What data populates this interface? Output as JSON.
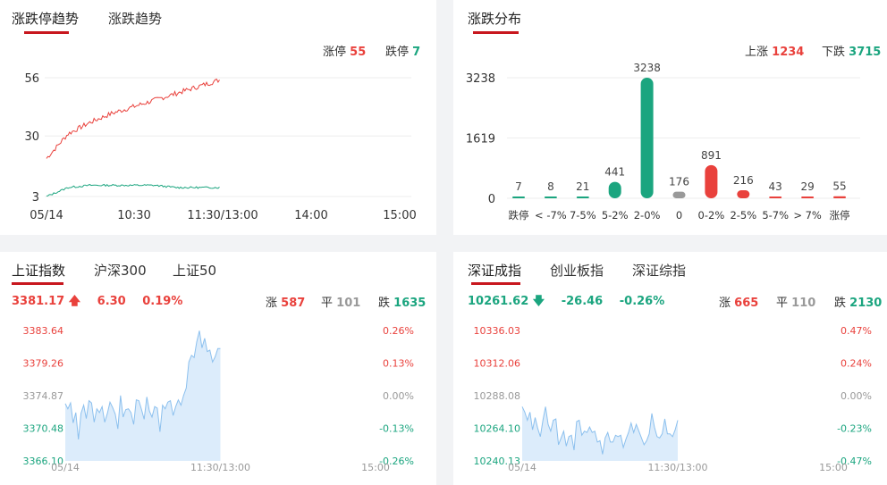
{
  "trend": {
    "tabs": [
      {
        "label": "涨跌停趋势"
      },
      {
        "label": "涨跌趋势"
      }
    ],
    "limit_up_label": "涨停",
    "limit_up_value": "55",
    "limit_down_label": "跌停",
    "limit_down_value": "7",
    "y_ticks": [
      "56",
      "30",
      "3"
    ],
    "x_ticks": [
      "05/14",
      "10:30",
      "11:30/13:00",
      "14:00",
      "15:00"
    ],
    "colors": {
      "up": "#e9413c",
      "down": "#1ba57f"
    }
  },
  "dist": {
    "title": "涨跌分布",
    "up_label": "上涨",
    "up_value": "1234",
    "down_label": "下跌",
    "down_value": "3715",
    "y_ticks": [
      "3238",
      "1619",
      "0"
    ]
  },
  "sh": {
    "tabs": [
      {
        "label": "上证指数"
      },
      {
        "label": "沪深300"
      },
      {
        "label": "上证50"
      }
    ],
    "price": "3381.17",
    "change": "6.30",
    "change_pct": "0.19%",
    "rise_label": "涨",
    "rise_value": "587",
    "flat_label": "平",
    "flat_value": "101",
    "fall_label": "跌",
    "fall_value": "1635",
    "left_ticks": [
      "3383.64",
      "3379.26",
      "3374.87",
      "3370.48",
      "3366.10"
    ],
    "right_ticks": [
      "0.26%",
      "0.13%",
      "0.00%",
      "-0.13%",
      "-0.26%"
    ],
    "x_ticks": [
      "05/14",
      "11:30/13:00",
      "15:00"
    ]
  },
  "sz": {
    "tabs": [
      {
        "label": "深证成指"
      },
      {
        "label": "创业板指"
      },
      {
        "label": "深证综指"
      }
    ],
    "price": "10261.62",
    "change": "-26.46",
    "change_pct": "-0.26%",
    "rise_label": "涨",
    "rise_value": "665",
    "flat_label": "平",
    "flat_value": "110",
    "fall_label": "跌",
    "fall_value": "2130",
    "left_ticks": [
      "10336.03",
      "10312.06",
      "10288.08",
      "10264.10",
      "10240.13"
    ],
    "right_ticks": [
      "0.47%",
      "0.24%",
      "0.00%",
      "-0.23%",
      "-0.47%"
    ],
    "x_ticks": [
      "05/14",
      "11:30/13:00",
      "15:00"
    ]
  },
  "chart_data": [
    {
      "type": "line",
      "x": [
        "05/14",
        "10:30",
        "11:30/13:00",
        "14:00",
        "15:00"
      ],
      "ylim": [
        3,
        56
      ],
      "series": [
        {
          "name": "涨停",
          "values": [
            20,
            31,
            36,
            40,
            43,
            46,
            49,
            52,
            55
          ]
        },
        {
          "name": "跌停",
          "values": [
            3,
            7,
            8,
            8,
            8,
            8,
            7,
            7,
            7
          ]
        }
      ]
    },
    {
      "type": "bar",
      "categories": [
        "跌停",
        "< -7%",
        "7-5%",
        "5-2%",
        "2-0%",
        "0",
        "0-2%",
        "2-5%",
        "5-7%",
        "> 7%",
        "涨停"
      ],
      "values": [
        7,
        8,
        21,
        441,
        3238,
        176,
        891,
        216,
        43,
        29,
        55
      ],
      "ylim": [
        0,
        3238
      ],
      "colors": [
        "#1ba57f",
        "#1ba57f",
        "#1ba57f",
        "#1ba57f",
        "#1ba57f",
        "#999999",
        "#e9413c",
        "#e9413c",
        "#e9413c",
        "#e9413c",
        "#e9413c"
      ]
    },
    {
      "type": "area",
      "x": [
        "05/14",
        "11:30/13:00",
        "15:00"
      ],
      "ylim": [
        3366.1,
        3383.64
      ],
      "series": [
        {
          "values": [
            3373.8,
            3373.1,
            3373.9,
            3371.2,
            3372.6,
            3369.0,
            3372.5,
            3373.6,
            3371.8,
            3374.2,
            3373.9,
            3371.3,
            3373.1,
            3372.6,
            3373.4,
            3371.3,
            3372.5,
            3374.0,
            3373.3,
            3372.4,
            3370.4,
            3374.9,
            3372.0,
            3373.0,
            3373.1,
            3372.6,
            3371.0,
            3374.3,
            3374.2,
            3373.0,
            3371.7,
            3374.7,
            3372.8,
            3372.0,
            3373.4,
            3373.2,
            3370.0,
            3373.6,
            3373.1,
            3374.0,
            3374.2,
            3372.2,
            3373.4,
            3374.3,
            3373.6,
            3374.9,
            3375.9,
            3379.4,
            3380.3,
            3380.0,
            3382.1,
            3383.6,
            3381.3,
            3382.6,
            3380.8,
            3381.0,
            3379.4,
            3380.1,
            3381.2,
            3381.2
          ]
        }
      ]
    },
    {
      "type": "area",
      "x": [
        "05/14",
        "11:30/13:00",
        "15:00"
      ],
      "ylim": [
        10240.13,
        10336.03
      ],
      "series": [
        {
          "values": [
            10280,
            10276,
            10270,
            10276,
            10263,
            10272,
            10264,
            10258,
            10270,
            10280,
            10267,
            10262,
            10270,
            10271,
            10252,
            10257,
            10262,
            10251,
            10258,
            10259,
            10248,
            10269,
            10270,
            10259,
            10262,
            10261,
            10265,
            10261,
            10262,
            10254,
            10255,
            10245,
            10257,
            10261,
            10254,
            10254,
            10259,
            10258,
            10259,
            10250,
            10256,
            10261,
            10268,
            10261,
            10267,
            10262,
            10257,
            10252,
            10255,
            10260,
            10275,
            10265,
            10258,
            10257,
            10260,
            10271,
            10260,
            10260,
            10258,
            10263,
            10270
          ]
        }
      ]
    }
  ]
}
